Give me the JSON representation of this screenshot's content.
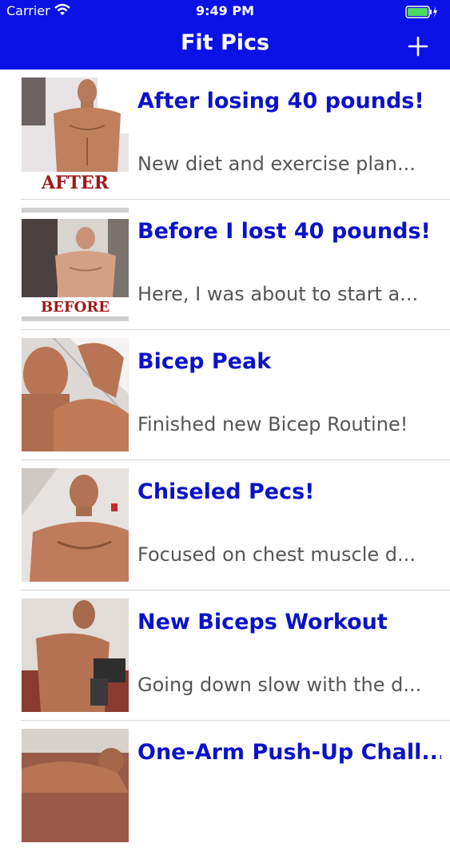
{
  "status_bar": {
    "carrier": "Carrier",
    "time": "9:49 PM",
    "icons": [
      "wifi-icon",
      "battery-icon",
      "charging-icon"
    ]
  },
  "nav": {
    "title": "Fit Pics",
    "add_button_icon": "plus-icon"
  },
  "colors": {
    "nav_background": "#0a12e6",
    "title_text": "#0a12c8",
    "subtitle_text": "#555555",
    "battery": "#4cd964"
  },
  "posts": [
    {
      "title": "After losing 40 pounds!",
      "subtitle": "New diet and exercise plan...",
      "thumbnail_caption": "AFTER"
    },
    {
      "title": "Before I lost 40 pounds!",
      "subtitle": "Here, I was about to start a...",
      "thumbnail_caption": "BEFORE"
    },
    {
      "title": "Bicep Peak",
      "subtitle": "Finished new Bicep Routine!"
    },
    {
      "title": "Chiseled Pecs!",
      "subtitle": "Focused on chest muscle d..."
    },
    {
      "title": "New Biceps Workout",
      "subtitle": "Going down slow with the d..."
    },
    {
      "title": "One-Arm Push-Up Chall...",
      "subtitle": ""
    }
  ]
}
